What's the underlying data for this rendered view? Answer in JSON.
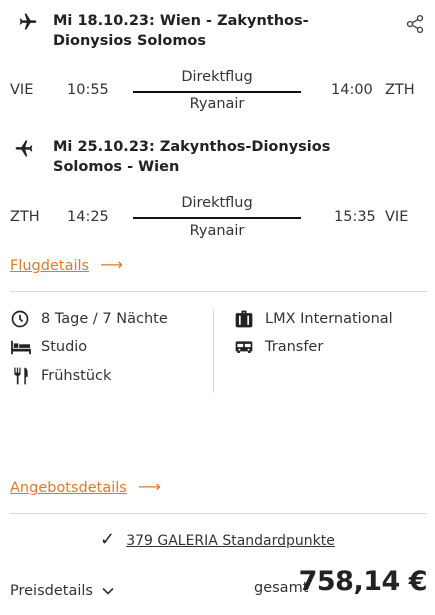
{
  "legs": [
    {
      "title": "Mi 18.10.23: Wien - Zakynthos-Dionysios Solomos",
      "from_code": "VIE",
      "dep_time": "10:55",
      "flight_type": "Direktflug",
      "airline": "Ryanair",
      "arr_time": "14:00",
      "to_code": "ZTH"
    },
    {
      "title": "Mi 25.10.23: Zakynthos-Dionysios Solomos - Wien",
      "from_code": "ZTH",
      "dep_time": "14:25",
      "flight_type": "Direktflug",
      "airline": "Ryanair",
      "arr_time": "15:35",
      "to_code": "VIE"
    }
  ],
  "links": {
    "flight_details": "Flugdetails",
    "offer_details": "Angebotsdetails",
    "arrow": "⟶"
  },
  "features": {
    "duration": "8 Tage / 7 Nächte",
    "room": "Studio",
    "board": "Frühstück",
    "operator": "LMX International",
    "transfer": "Transfer"
  },
  "points": {
    "text": "379 GALERIA Standardpunkte",
    "check": "✓"
  },
  "price": {
    "details_label": "Preisdetails",
    "total_label": "gesamt",
    "amount": "758,14 €"
  },
  "colors": {
    "accent": "#e07a2b",
    "text": "#222222",
    "divider": "#d9d9d9"
  },
  "icons": [
    "plane-out-icon",
    "share-icon",
    "plane-return-icon",
    "clock-icon",
    "bed-icon",
    "cutlery-icon",
    "suitcase-icon",
    "bus-icon",
    "check-icon",
    "chevron-down-icon"
  ]
}
